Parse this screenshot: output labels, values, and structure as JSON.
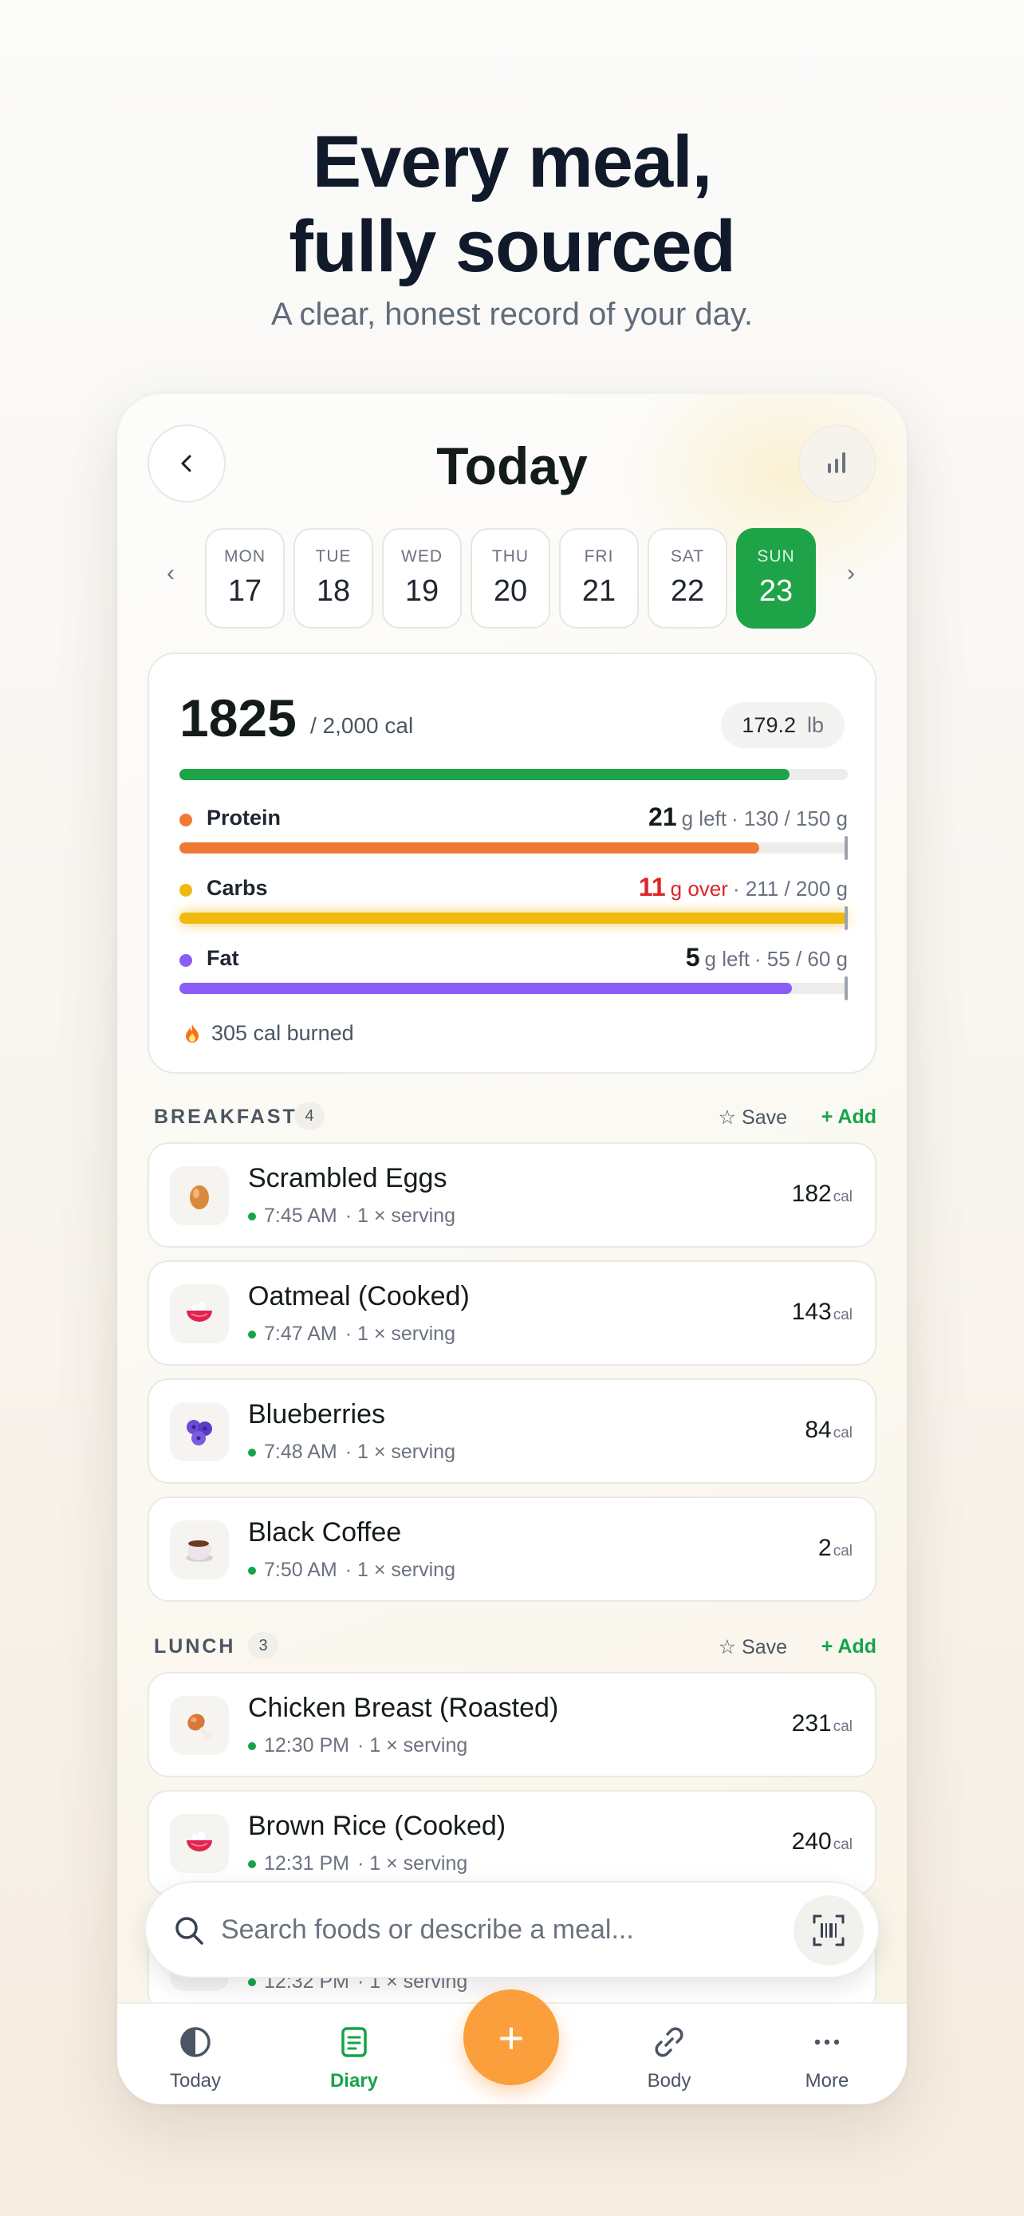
{
  "hero": {
    "line1": "Every meal,",
    "line2": "fully sourced",
    "subtitle": "A clear, honest record of your day."
  },
  "header": {
    "title": "Today",
    "back_icon": "chevron-left-icon",
    "stats_icon": "bar-chart-icon"
  },
  "week": {
    "prev": "‹",
    "next": "›",
    "days": [
      {
        "name": "MON",
        "date": "17",
        "active": false
      },
      {
        "name": "TUE",
        "date": "18",
        "active": false
      },
      {
        "name": "WED",
        "date": "19",
        "active": false
      },
      {
        "name": "THU",
        "date": "20",
        "active": false
      },
      {
        "name": "FRI",
        "date": "21",
        "active": false
      },
      {
        "name": "SAT",
        "date": "22",
        "active": false
      },
      {
        "name": "SUN",
        "date": "23",
        "active": true
      }
    ]
  },
  "summary": {
    "calories": "1825",
    "goal": "/ 2,000 cal",
    "calories_progress": 0.9125,
    "weight_value": "179.2",
    "weight_unit": "lb",
    "macros": [
      {
        "name": "Protein",
        "amount": "21",
        "word": "g left",
        "detail": "· 130 / 150 g",
        "progress": 0.867,
        "over": false,
        "color": "#f07a35"
      },
      {
        "name": "Carbs",
        "amount": "11",
        "word": "g over",
        "detail": "· 211 / 200 g",
        "progress": 1.0,
        "over": true,
        "color": "#efb90f"
      },
      {
        "name": "Fat",
        "amount": "5",
        "word": "g left",
        "detail": "· 55 / 60 g",
        "progress": 0.917,
        "over": false,
        "color": "#8b5cf6"
      }
    ],
    "burned": "305 cal burned",
    "colors": {
      "calories_bar": "#1fa348",
      "track": "#ececea"
    }
  },
  "breakfast": {
    "label": "BREAKFAST",
    "count": "4",
    "save": "☆ Save",
    "add": "+ Add",
    "items": [
      {
        "name": "Scrambled Eggs",
        "time": "7:45 AM",
        "serving": "· 1 × serving",
        "cal": "182",
        "unit": "cal",
        "icon": "egg-icon"
      },
      {
        "name": "Oatmeal (Cooked)",
        "time": "7:47 AM",
        "serving": "· 1 × serving",
        "cal": "143",
        "unit": "cal",
        "icon": "bowl-icon"
      },
      {
        "name": "Blueberries",
        "time": "7:48 AM",
        "serving": "· 1 × serving",
        "cal": "84",
        "unit": "cal",
        "icon": "blueberries-icon"
      },
      {
        "name": "Black Coffee",
        "time": "7:50 AM",
        "serving": "· 1 × serving",
        "cal": "2",
        "unit": "cal",
        "icon": "coffee-icon"
      }
    ]
  },
  "lunch": {
    "label": "LUNCH",
    "count": "3",
    "save": "☆ Save",
    "add": "+ Add",
    "items": [
      {
        "name": "Chicken Breast (Roasted)",
        "time": "12:30 PM",
        "serving": "· 1 × serving",
        "cal": "231",
        "unit": "cal",
        "icon": "drumstick-icon"
      },
      {
        "name": "Brown Rice (Cooked)",
        "time": "12:31 PM",
        "serving": "· 1 × serving",
        "cal": "240",
        "unit": "cal",
        "icon": "bowl-icon"
      },
      {
        "name": "",
        "time": "12:32 PM",
        "serving": "· 1 × serving",
        "cal": "",
        "unit": "",
        "icon": ""
      }
    ]
  },
  "search": {
    "placeholder": "Search foods or describe a meal...",
    "icon": "search-icon",
    "scan_icon": "barcode-scan-icon"
  },
  "tabs": [
    {
      "label": "Today",
      "icon": "half-circle-icon",
      "active": false
    },
    {
      "label": "Diary",
      "icon": "notebook-icon",
      "active": true
    },
    {
      "label": "Body",
      "icon": "link-icon",
      "active": false
    },
    {
      "label": "More",
      "icon": "more-dots-icon",
      "active": false
    }
  ],
  "fab": {
    "label": "+"
  }
}
